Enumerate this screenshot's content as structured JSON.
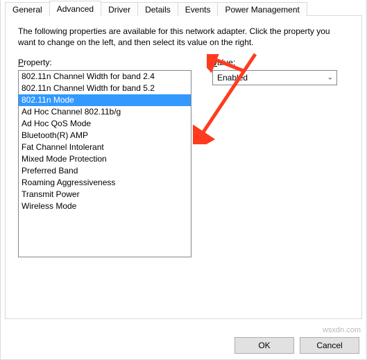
{
  "tabs": {
    "general": "General",
    "advanced": "Advanced",
    "driver": "Driver",
    "details": "Details",
    "events": "Events",
    "power": "Power Management"
  },
  "active_tab": "advanced",
  "description": "The following properties are available for this network adapter. Click the property you want to change on the left, and then select its value on the right.",
  "property_label_pre": "",
  "property_label_u": "P",
  "property_label_post": "roperty:",
  "value_label_pre": "",
  "value_label_u": "V",
  "value_label_post": "alue:",
  "properties": [
    "802.11n Channel Width for band 2.4",
    "802.11n Channel Width for band 5.2",
    "802.11n Mode",
    "Ad Hoc Channel 802.11b/g",
    "Ad Hoc QoS Mode",
    "Bluetooth(R) AMP",
    "Fat Channel Intolerant",
    "Mixed Mode Protection",
    "Preferred Band",
    "Roaming Aggressiveness",
    "Transmit Power",
    "Wireless Mode"
  ],
  "selected_property_index": 2,
  "value_selected": "Enabled",
  "buttons": {
    "ok": "OK",
    "cancel": "Cancel"
  },
  "watermark": "wsxdn.com"
}
